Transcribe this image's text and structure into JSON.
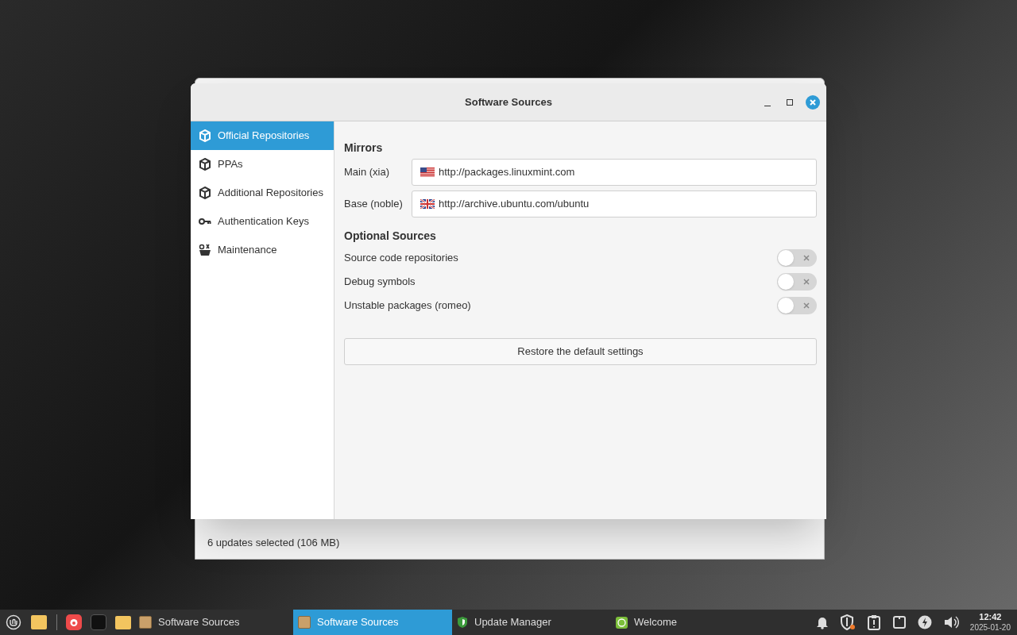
{
  "background_window": {
    "status": "6 updates selected (106 MB)"
  },
  "window": {
    "title": "Software Sources"
  },
  "sidebar": {
    "items": [
      {
        "label": "Official Repositories",
        "kind": "package",
        "selected": true
      },
      {
        "label": "PPAs",
        "kind": "package",
        "selected": false
      },
      {
        "label": "Additional Repositories",
        "kind": "package",
        "selected": false
      },
      {
        "label": "Authentication Keys",
        "kind": "key",
        "selected": false
      },
      {
        "label": "Maintenance",
        "kind": "tools",
        "selected": false
      }
    ]
  },
  "mirrors": {
    "heading": "Mirrors",
    "rows": [
      {
        "label": "Main (xia)",
        "kind": "us",
        "value": "http://packages.linuxmint.com"
      },
      {
        "label": "Base (noble)",
        "kind": "gb",
        "value": "http://archive.ubuntu.com/ubuntu"
      }
    ]
  },
  "optional_sources": {
    "heading": "Optional Sources",
    "items": [
      {
        "label": "Source code repositories",
        "on": false
      },
      {
        "label": "Debug symbols",
        "on": false
      },
      {
        "label": "Unstable packages (romeo)",
        "on": false
      }
    ]
  },
  "restore_button": "Restore the default settings",
  "taskbar": {
    "tasks": [
      {
        "label": "Software Sources",
        "kind": "package",
        "selected": false
      },
      {
        "label": "Software Sources",
        "kind": "package",
        "selected": true
      },
      {
        "label": "Update Manager",
        "kind": "shield",
        "selected": false
      },
      {
        "label": "Welcome",
        "kind": "mint",
        "selected": false
      }
    ],
    "clock": {
      "time": "12:42",
      "date": "2025-01-20"
    }
  }
}
